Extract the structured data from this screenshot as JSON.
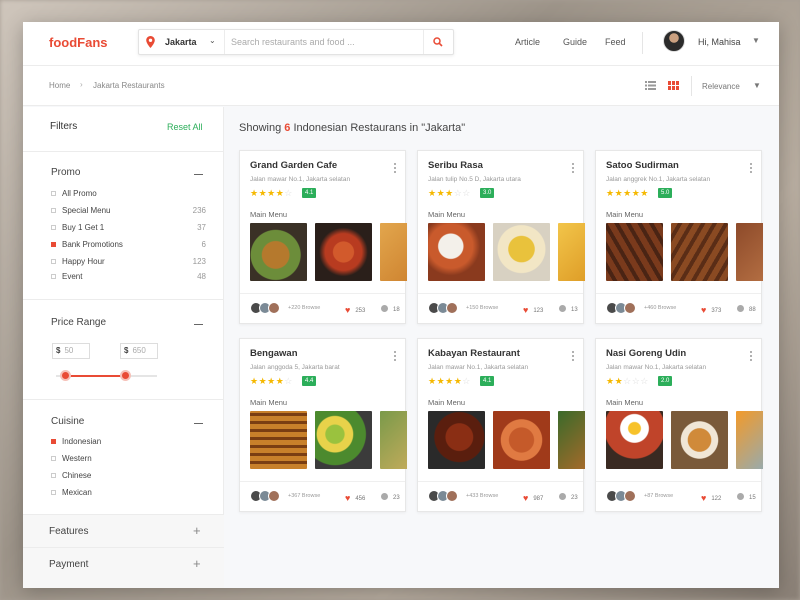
{
  "app": {
    "logo": "foodFans"
  },
  "header": {
    "location": "Jakarta",
    "search_placeholder": "Search restaurants and food ...",
    "nav": [
      "Article",
      "Guide",
      "Feed"
    ],
    "user": "Hi, Mahisa"
  },
  "breadcrumb": {
    "home": "Home",
    "current": "Jakarta Restaurants",
    "sort": "Relevance"
  },
  "sidebar": {
    "title": "Filters",
    "reset": "Reset All",
    "promo": {
      "title": "Promo",
      "items": [
        {
          "label": "All Promo",
          "count": "",
          "checked": false
        },
        {
          "label": "Special Menu",
          "count": "236",
          "checked": false
        },
        {
          "label": "Buy 1 Get 1",
          "count": "37",
          "checked": false
        },
        {
          "label": "Bank Promotions",
          "count": "6",
          "checked": true
        },
        {
          "label": "Happy Hour",
          "count": "123",
          "checked": false
        },
        {
          "label": "Event",
          "count": "48",
          "checked": false
        }
      ]
    },
    "price": {
      "title": "Price Range",
      "currency": "$",
      "min": "50",
      "max": "650"
    },
    "cuisine": {
      "title": "Cuisine",
      "items": [
        {
          "label": "Indonesian",
          "checked": true
        },
        {
          "label": "Western",
          "checked": false
        },
        {
          "label": "Chinese",
          "checked": false
        },
        {
          "label": "Mexican",
          "checked": false
        }
      ]
    },
    "features": "Features",
    "payment": "Payment"
  },
  "results": {
    "prefix": "Showing",
    "count": "6",
    "suffix": "Indonesian Restaurans in \"Jakarta\""
  },
  "cards": [
    {
      "name": "Grand Garden Cafe",
      "address": "Jalan mawar No.1, Jakarta selatan",
      "stars": 4,
      "rating": "4.1",
      "menu": "Main Menu",
      "browse": "+220 Browse",
      "likes": "253",
      "comments": "18"
    },
    {
      "name": "Seribu Rasa",
      "address": "Jalan tulip No.5 D, Jakarta utara",
      "stars": 3,
      "rating": "3.0",
      "menu": "Main Menu",
      "browse": "+150 Browse",
      "likes": "123",
      "comments": "13"
    },
    {
      "name": "Satoo Sudirman",
      "address": "Jalan anggrek No.1, Jakarta selatan",
      "stars": 5,
      "rating": "5.0",
      "menu": "Main Menu",
      "browse": "+460 Browse",
      "likes": "373",
      "comments": "88"
    },
    {
      "name": "Bengawan",
      "address": "Jalan anggoda 5, Jakarta barat",
      "stars": 4,
      "rating": "4.4",
      "menu": "Main Menu",
      "browse": "+367 Browse",
      "likes": "456",
      "comments": "23"
    },
    {
      "name": "Kabayan Restaurant",
      "address": "Jalan mawar No.1, Jakarta selatan",
      "stars": 4,
      "rating": "4.1",
      "menu": "Main Menu",
      "browse": "+433 Browse",
      "likes": "987",
      "comments": "23"
    },
    {
      "name": "Nasi Goreng Udin",
      "address": "Jalan mawar No.1, Jakarta selatan",
      "stars": 2,
      "rating": "2.0",
      "menu": "Main Menu",
      "browse": "+87 Browse",
      "likes": "122",
      "comments": "15"
    }
  ],
  "colors": {
    "accent": "#e94b35",
    "green": "#2cae5a",
    "star": "#f5b800"
  }
}
